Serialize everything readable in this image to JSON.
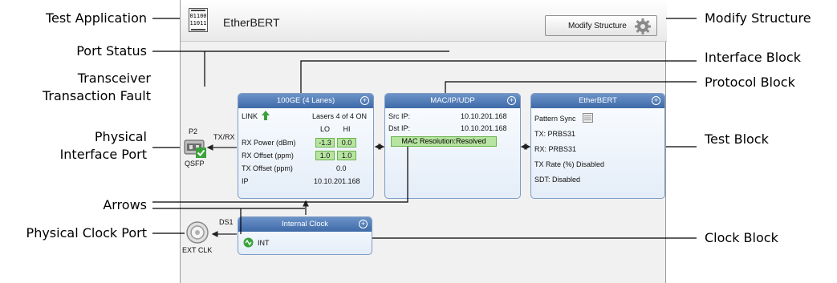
{
  "callouts_left": {
    "test_application": "Test Application",
    "port_status": "Port Status",
    "transceiver_line1": "Transceiver",
    "transceiver_line2": "Transaction Fault",
    "physical_interface_line1": "Physical",
    "physical_interface_line2": "Interface Port",
    "arrows": "Arrows",
    "physical_clock_port": "Physical Clock Port"
  },
  "callouts_right": {
    "modify_structure": "Modify Structure",
    "interface_block": "Interface Block",
    "protocol_block": "Protocol Block",
    "test_block": "Test Block",
    "clock_block": "Clock Block"
  },
  "app": {
    "icon_text": "01100 11011",
    "title": "EtherBERT",
    "modify_button": "Modify Structure"
  },
  "port": {
    "name": "P2",
    "direction": "TX/RX",
    "type": "QSFP"
  },
  "clock_port": {
    "name": "DS1",
    "label": "EXT CLK"
  },
  "interface_block": {
    "title": "100GE (4 Lanes)",
    "link": "LINK",
    "lasers": "Lasers 4 of 4 ON",
    "col_lo": "LO",
    "col_hi": "HI",
    "rx_power_label": "RX Power (dBm)",
    "rx_power_lo": "-1.3",
    "rx_power_hi": "0.0",
    "rx_offset_label": "RX Offset (ppm)",
    "rx_offset_lo": "1.0",
    "rx_offset_hi": "1.0",
    "tx_offset_label": "TX Offset (ppm)",
    "tx_offset_value": "0.0",
    "ip_label": "IP",
    "ip_value": "10.10.201.168"
  },
  "protocol_block": {
    "title": "MAC/IP/UDP",
    "src_ip_label": "Src IP:",
    "src_ip_value": "10.10.201.168",
    "dst_ip_label": "Dst IP:",
    "dst_ip_value": "10.10.201.168",
    "mac_resolution": "MAC Resolution:Resolved"
  },
  "test_block": {
    "title": "EtherBERT",
    "pattern_sync": "Pattern Sync",
    "tx": "TX: PRBS31",
    "rx": "RX: PRBS31",
    "tx_rate": "TX Rate (%) Disabled",
    "sdt": "SDT: Disabled"
  },
  "clock_block": {
    "title": "Internal Clock",
    "value": "INT"
  },
  "colors": {
    "block_header": "#4a76b2",
    "status_green": "#b7e4a0",
    "link_arrow": "#3aa23a"
  },
  "icons": [
    "app-icon",
    "gear-icon",
    "expand-icon",
    "link-up-icon",
    "qsfp-port-icon",
    "check-icon",
    "bnc-connector-icon",
    "pattern-sync-icon",
    "clock-source-icon"
  ]
}
